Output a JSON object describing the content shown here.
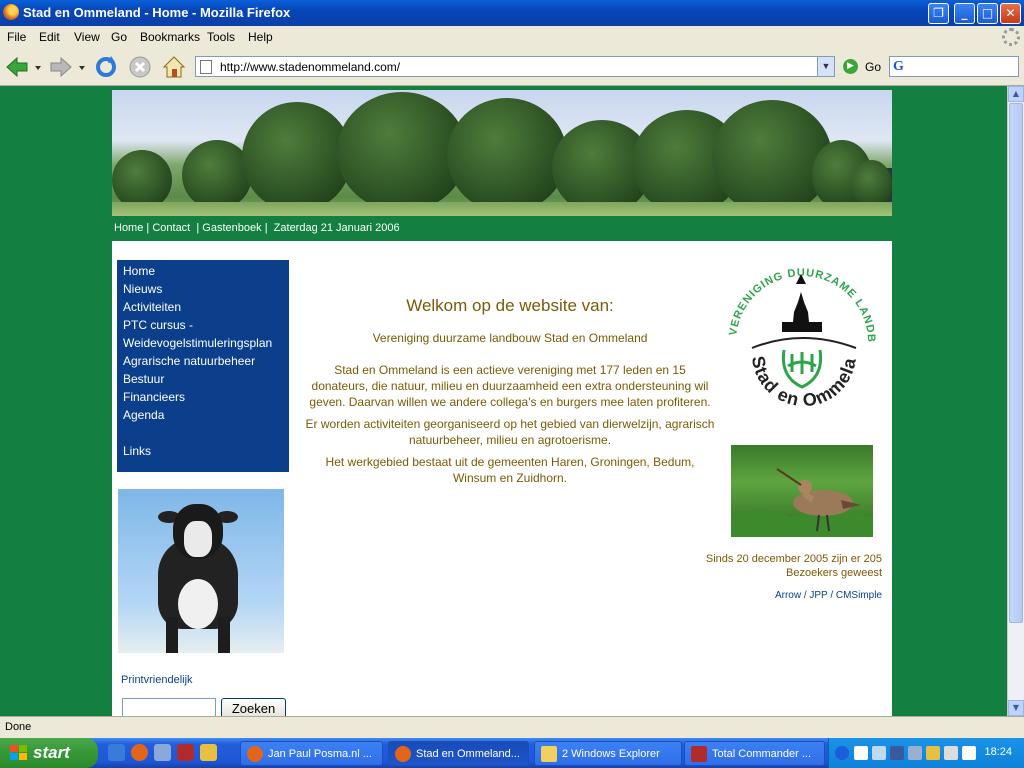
{
  "window": {
    "title": "Stad en Ommeland - Home - Mozilla Firefox",
    "buttons": {
      "restore": "❐",
      "minimize": "_",
      "maximize": "□",
      "close": "✕"
    }
  },
  "menu": [
    "File",
    "Edit",
    "View",
    "Go",
    "Bookmarks",
    "Tools",
    "Help"
  ],
  "toolbar": {
    "url": "http://www.stadenommeland.com/",
    "go_label": "Go",
    "search_engine_icon": "G"
  },
  "site": {
    "top_links": {
      "home": "Home",
      "contact": "Contact",
      "guestbook": "Gastenboek",
      "date": "Zaterdag 21 Januari 2006",
      "separator": "|"
    },
    "nav": [
      "Home",
      "Nieuws",
      "Activiteiten",
      "PTC cursus -",
      "Weidevogelstimuleringsplan",
      "Agrarische natuurbeheer",
      "Bestuur",
      "Financieers",
      "Agenda",
      "",
      "Links"
    ],
    "print_link": "Printvriendelijk",
    "search_button": "Zoeken",
    "search_value": "",
    "welcome": "Welkom op de website van:",
    "subtitle": "Vereniging duurzame landbouw Stad en Ommeland",
    "paragraphs": [
      "Stad en Ommeland is een actieve vereniging met 177 leden en 15 donateurs, die natuur, milieu en duurzaamheid een extra ondersteuning wil geven. Daarvan willen we andere collega's en burgers mee laten profiteren.",
      "Er worden activiteiten georganiseerd op het gebied van dierwelzijn, agrarisch natuurbeheer, milieu en agrotoerisme.",
      "Het werkgebied bestaat uit de gemeenten Haren, Groningen, Bedum, Winsum en Zuidhorn."
    ],
    "logo": {
      "arc_text": "VERENIGING DUURZAME LANDBOUW",
      "bottom_text": "Stad en Ommeland"
    },
    "counter": "Sinds 20 december 2005 zijn er 205 Bezoekers geweest",
    "credits": "Arrow / JPP / CMSimple"
  },
  "status": "Done",
  "taskbar": {
    "start": "start",
    "tasks": [
      "Jan Paul Posma.nl ...",
      "Stad en Ommeland...",
      "2 Windows Explorer",
      "Total Commander ..."
    ],
    "clock": "18:24"
  },
  "colors": {
    "page_background": "#138042",
    "nav_background": "#0b3f8c",
    "text_brown": "#7a5a08",
    "logo_green": "#2ea44a"
  }
}
